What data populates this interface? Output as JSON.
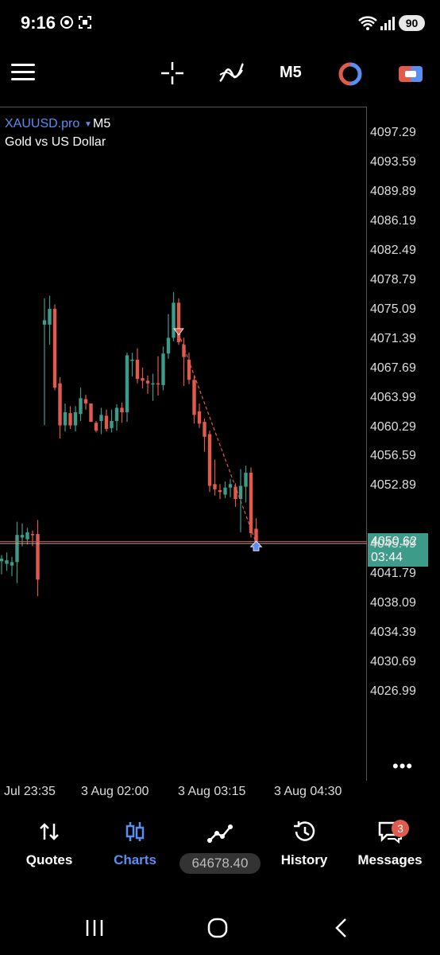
{
  "status_bar": {
    "time": "9:16",
    "battery": "90"
  },
  "toolbar": {
    "timeframe": "M5"
  },
  "chart": {
    "symbol": "XAUUSD.pro",
    "symbol_tf": "M5",
    "description": "Gold vs US Dollar",
    "price_labels": [
      "4097.29",
      "4093.59",
      "4089.89",
      "4086.19",
      "4082.49",
      "4078.79",
      "4075.09",
      "4071.39",
      "4067.69",
      "4063.99",
      "4060.29",
      "4056.59",
      "4052.89",
      "4045.49",
      "4041.79",
      "4038.09",
      "4034.39",
      "4030.69",
      "4026.99"
    ],
    "current_price": "4050.62",
    "countdown": "03:44",
    "time_labels": [
      "Jul 23:35",
      "3 Aug 02:00",
      "3 Aug 03:15",
      "3 Aug 04:30"
    ],
    "colors": {
      "bull": "#3d9b8a",
      "bear": "#e05a4e",
      "accent": "#5b8ef0"
    }
  },
  "chart_data": {
    "type": "candlestick",
    "y_unit": "price",
    "ylim": [
      4024,
      4099
    ],
    "candles": [
      {
        "o": 4048.5,
        "h": 4049.2,
        "l": 4047.0,
        "c": 4048.8
      },
      {
        "o": 4048.2,
        "h": 4049.5,
        "l": 4047.4,
        "c": 4048.6
      },
      {
        "o": 4048.0,
        "h": 4049.0,
        "l": 4046.8,
        "c": 4048.4
      },
      {
        "o": 4048.4,
        "h": 4053.0,
        "l": 4046.0,
        "c": 4051.5
      },
      {
        "o": 4051.2,
        "h": 4052.8,
        "l": 4050.2,
        "c": 4051.5
      },
      {
        "o": 4051.0,
        "h": 4052.3,
        "l": 4050.4,
        "c": 4051.8
      },
      {
        "o": 4051.6,
        "h": 4052.0,
        "l": 4050.2,
        "c": 4051.5
      },
      {
        "o": 4051.6,
        "h": 4053.2,
        "l": 4044.5,
        "c": 4046.4
      },
      {
        "o": 4075.5,
        "h": 4078.5,
        "l": 4064.0,
        "c": 4076.0
      },
      {
        "o": 4075.5,
        "h": 4078.8,
        "l": 4073.2,
        "c": 4077.3
      },
      {
        "o": 4077.3,
        "h": 4077.8,
        "l": 4068.0,
        "c": 4068.3
      },
      {
        "o": 4068.8,
        "h": 4069.5,
        "l": 4062.5,
        "c": 4064.0
      },
      {
        "o": 4064.0,
        "h": 4066.5,
        "l": 4063.3,
        "c": 4065.5
      },
      {
        "o": 4065.4,
        "h": 4066.2,
        "l": 4063.6,
        "c": 4064.0
      },
      {
        "o": 4064.0,
        "h": 4066.2,
        "l": 4063.3,
        "c": 4065.5
      },
      {
        "o": 4065.3,
        "h": 4068.3,
        "l": 4064.5,
        "c": 4067.1
      },
      {
        "o": 4067.0,
        "h": 4067.5,
        "l": 4065.8,
        "c": 4066.5
      },
      {
        "o": 4066.5,
        "h": 4066.5,
        "l": 4064.4,
        "c": 4064.4
      },
      {
        "o": 4064.3,
        "h": 4064.5,
        "l": 4063.2,
        "c": 4063.4
      },
      {
        "o": 4064.5,
        "h": 4066.0,
        "l": 4063.0,
        "c": 4065.2
      },
      {
        "o": 4065.1,
        "h": 4065.8,
        "l": 4063.3,
        "c": 4063.6
      },
      {
        "o": 4063.7,
        "h": 4065.8,
        "l": 4063.2,
        "c": 4064.5
      },
      {
        "o": 4064.5,
        "h": 4066.4,
        "l": 4063.4,
        "c": 4066.0
      },
      {
        "o": 4066.0,
        "h": 4066.6,
        "l": 4064.3,
        "c": 4065.5
      },
      {
        "o": 4065.5,
        "h": 4072.3,
        "l": 4064.4,
        "c": 4072.0
      },
      {
        "o": 4071.5,
        "h": 4072.3,
        "l": 4069.6,
        "c": 4071.5
      },
      {
        "o": 4071.5,
        "h": 4072.8,
        "l": 4068.8,
        "c": 4069.3
      },
      {
        "o": 4069.4,
        "h": 4070.6,
        "l": 4068.2,
        "c": 4069.1
      },
      {
        "o": 4069.1,
        "h": 4069.7,
        "l": 4067.6,
        "c": 4068.8
      },
      {
        "o": 4068.8,
        "h": 4069.9,
        "l": 4066.8,
        "c": 4068.8
      },
      {
        "o": 4068.8,
        "h": 4071.9,
        "l": 4067.4,
        "c": 4068.7
      },
      {
        "o": 4068.6,
        "h": 4073.0,
        "l": 4068.0,
        "c": 4072.2
      },
      {
        "o": 4072.2,
        "h": 4076.7,
        "l": 4071.6,
        "c": 4074.0
      },
      {
        "o": 4074.0,
        "h": 4079.2,
        "l": 4073.6,
        "c": 4078.0
      },
      {
        "o": 4078.0,
        "h": 4078.5,
        "l": 4073.2,
        "c": 4073.5
      },
      {
        "o": 4073.2,
        "h": 4074.0,
        "l": 4068.5,
        "c": 4071.8
      },
      {
        "o": 4071.5,
        "h": 4072.3,
        "l": 4068.7,
        "c": 4069.2
      },
      {
        "o": 4069.2,
        "h": 4069.7,
        "l": 4064.2,
        "c": 4065.2
      },
      {
        "o": 4065.6,
        "h": 4066.5,
        "l": 4063.7,
        "c": 4064.2
      },
      {
        "o": 4064.4,
        "h": 4064.8,
        "l": 4061.0,
        "c": 4062.7
      },
      {
        "o": 4063.0,
        "h": 4063.4,
        "l": 4056.4,
        "c": 4057.1
      },
      {
        "o": 4057.3,
        "h": 4060.1,
        "l": 4056.0,
        "c": 4056.7
      },
      {
        "o": 4056.6,
        "h": 4057.3,
        "l": 4055.6,
        "c": 4056.4
      },
      {
        "o": 4056.1,
        "h": 4057.6,
        "l": 4055.7,
        "c": 4056.9
      },
      {
        "o": 4056.9,
        "h": 4057.9,
        "l": 4055.8,
        "c": 4057.3
      },
      {
        "o": 4057.0,
        "h": 4057.4,
        "l": 4054.7,
        "c": 4055.6
      },
      {
        "o": 4055.6,
        "h": 4059.0,
        "l": 4051.8,
        "c": 4057.1
      },
      {
        "o": 4057.0,
        "h": 4059.4,
        "l": 4055.2,
        "c": 4058.6
      },
      {
        "o": 4058.6,
        "h": 4059.2,
        "l": 4051.2,
        "c": 4051.7
      },
      {
        "o": 4052.2,
        "h": 4053.4,
        "l": 4050.2,
        "c": 4050.6
      }
    ]
  },
  "nav": {
    "quotes": "Quotes",
    "charts": "Charts",
    "balance": "64678.40",
    "history": "History",
    "messages": "Messages",
    "messages_badge": "3"
  }
}
